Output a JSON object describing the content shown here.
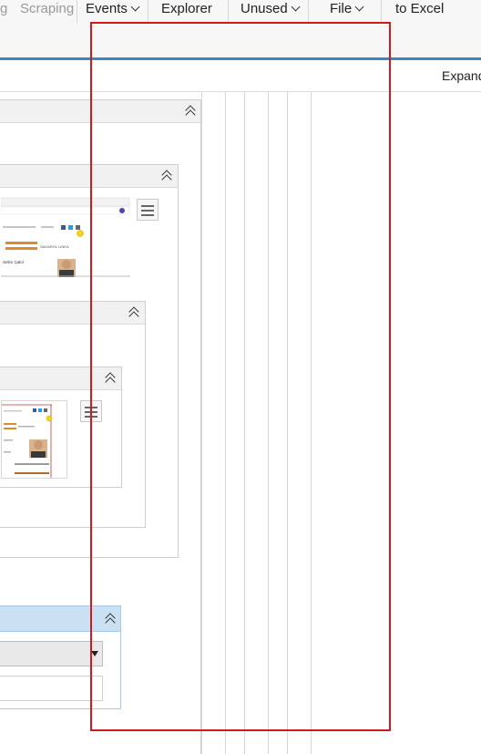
{
  "ribbon": {
    "items": [
      {
        "label": "g",
        "dim": true
      },
      {
        "label": "Scraping",
        "dim": true
      },
      {
        "label": "Events",
        "dropdown": true
      },
      {
        "label": "Explorer"
      },
      {
        "label": "Unused",
        "dropdown": true
      },
      {
        "label": "File",
        "dropdown": true
      },
      {
        "label": "to Excel"
      }
    ]
  },
  "header": {
    "expand_label": "Expand"
  },
  "thumbnail_texts": {
    "large_name_tag": "Selim Çakır",
    "large_banner": "SAHAROL LINKA"
  },
  "colors": {
    "accent_blue": "#3d86c6",
    "selection_red": "#d11b1b",
    "panel_header_blue": "#c9e1f3"
  }
}
